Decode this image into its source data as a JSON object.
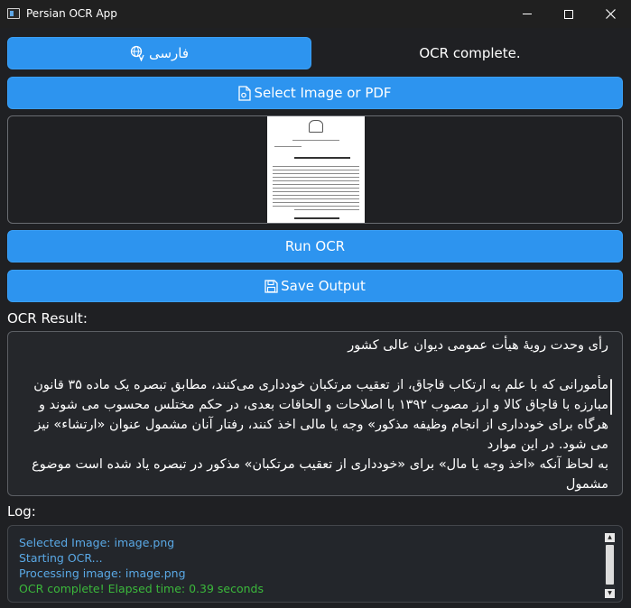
{
  "window": {
    "title": "Persian OCR App"
  },
  "toolbar": {
    "language_label": "فارسی",
    "select_label": "Select Image or PDF",
    "run_label": "Run OCR",
    "save_label": "Save Output"
  },
  "status": {
    "text": "OCR complete."
  },
  "result": {
    "label": "OCR Result:",
    "text": "رأی وحدت رویهٔ هیأت عمومی دیوان عالی کشور\n\nمأمورانی که با علم به ارتکاب قاچاق، از تعقیب مرتکبان خودداری می‌کنند، مطابق تبصره یک ماده ۳۵ قانون مبارزه با قاچاق کالا و ارز مصوب ۱۳۹۲ با اصلاحات و الحاقات بعدی، در حکم مختلس محسوب می شوند و هرگاه برای خودداری از انجام وظیفه مذکور» وجه یا مالی اخذ کنند، رفتار آنان مشمول عنوان «ارتشاء» نیز می شود. در این موارد\nبه لحاظ آنکه «اخذ وجه یا مال» برای «خودداری از تعقیب مرتکبان» مذکور در تبصره یاد شده است موضوع مشمول"
  },
  "log": {
    "label": "Log:",
    "lines": [
      "Selected Image: image.png",
      "Starting OCR...",
      "Processing image: image.png",
      "OCR complete! Elapsed time: 0.39 seconds"
    ]
  },
  "colors": {
    "accent": "#2d94ef",
    "log_info": "#5aa9e6",
    "log_success": "#3bb83b"
  },
  "icons": {
    "language": "translate-icon",
    "select": "file-image-icon",
    "save": "floppy-disk-icon"
  }
}
